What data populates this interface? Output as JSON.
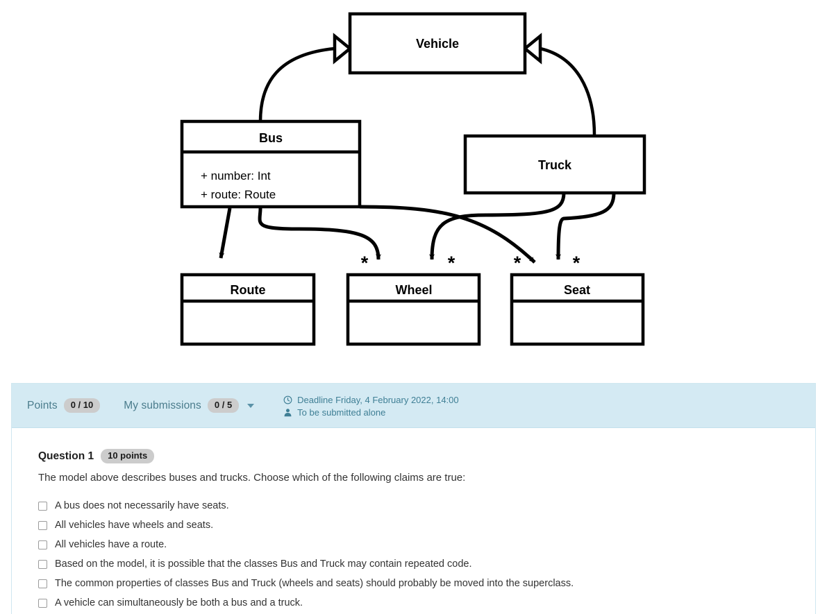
{
  "diagram": {
    "type": "uml-class-diagram",
    "classes": [
      {
        "name": "Vehicle",
        "attributes": []
      },
      {
        "name": "Bus",
        "attributes": [
          "+ number: Int",
          "+ route: Route"
        ]
      },
      {
        "name": "Truck",
        "attributes": []
      },
      {
        "name": "Route",
        "attributes": []
      },
      {
        "name": "Wheel",
        "attributes": []
      },
      {
        "name": "Seat",
        "attributes": []
      }
    ],
    "relations": [
      {
        "from": "Bus",
        "to": "Vehicle",
        "kind": "generalization",
        "multiplicity": ""
      },
      {
        "from": "Truck",
        "to": "Vehicle",
        "kind": "generalization",
        "multiplicity": ""
      },
      {
        "from": "Bus",
        "to": "Route",
        "kind": "association",
        "multiplicity": ""
      },
      {
        "from": "Bus",
        "to": "Wheel",
        "kind": "association",
        "multiplicity": "*"
      },
      {
        "from": "Bus",
        "to": "Seat",
        "kind": "association",
        "multiplicity": "*"
      },
      {
        "from": "Truck",
        "to": "Wheel",
        "kind": "association",
        "multiplicity": "*"
      },
      {
        "from": "Truck",
        "to": "Seat",
        "kind": "association",
        "multiplicity": "*"
      }
    ],
    "multiplicity_marks": [
      "*",
      "*",
      "*",
      "*"
    ]
  },
  "panel": {
    "points_label": "Points",
    "points_value": "0 / 10",
    "submissions_label": "My submissions",
    "submissions_value": "0 / 5",
    "deadline_text": "Deadline Friday, 4 February 2022, 14:00",
    "submitted_alone_text": "To be submitted alone",
    "header_bg": "#d4eaf3",
    "header_text_color": "#3f7f95"
  },
  "question": {
    "title": "Question 1",
    "points_badge": "10 points",
    "prompt": "The model above describes buses and trucks. Choose which of the following claims are true:",
    "options": [
      {
        "label": "A bus does not necessarily have seats.",
        "checked": false
      },
      {
        "label": "All vehicles have wheels and seats.",
        "checked": false
      },
      {
        "label": "All vehicles have a route.",
        "checked": false
      },
      {
        "label": "Based on the model, it is possible that the classes Bus and Truck may contain repeated code.",
        "checked": false
      },
      {
        "label": "The common properties of classes Bus and Truck (wheels and seats) should probably be moved into the superclass.",
        "checked": false
      },
      {
        "label": "A vehicle can simultaneously be both a bus and a truck.",
        "checked": false
      }
    ]
  }
}
